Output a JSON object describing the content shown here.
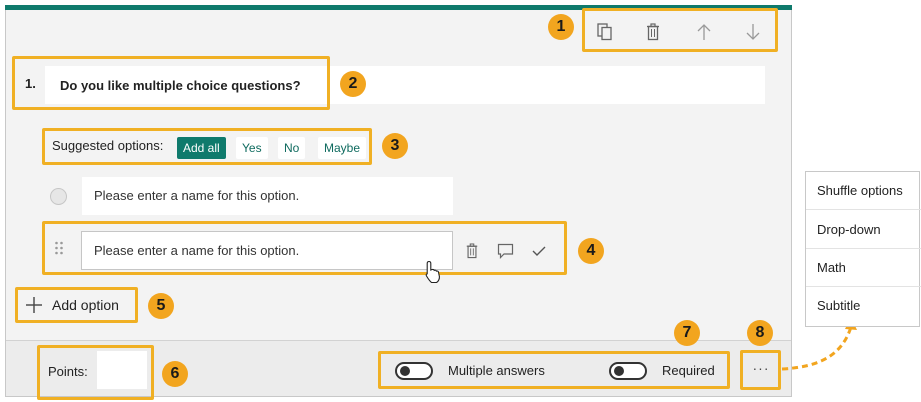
{
  "toolbar": {
    "copy_icon": "copy-icon",
    "delete_icon": "trash-icon",
    "move_up_icon": "arrow-up-icon",
    "move_down_icon": "arrow-down-icon"
  },
  "question": {
    "number": "1.",
    "title": "Do you like multiple choice questions?"
  },
  "suggested": {
    "label": "Suggested options:",
    "add_all": "Add all",
    "options": [
      "Yes",
      "No",
      "Maybe"
    ]
  },
  "options": [
    {
      "placeholder": "Please enter a name for this option."
    },
    {
      "placeholder": "Please enter a name for this option."
    }
  ],
  "add_option": "Add option",
  "footer": {
    "points_label": "Points:",
    "multiple_answers_label": "Multiple answers",
    "required_label": "Required",
    "more_label": "···"
  },
  "more_menu": {
    "items": [
      "Shuffle options",
      "Drop-down",
      "Math",
      "Subtitle"
    ]
  },
  "callouts": [
    "1",
    "2",
    "3",
    "4",
    "5",
    "6",
    "7",
    "8"
  ],
  "colors": {
    "accent": "#0f7a6c",
    "highlight": "#f0b024",
    "badge": "#f2a51f"
  }
}
